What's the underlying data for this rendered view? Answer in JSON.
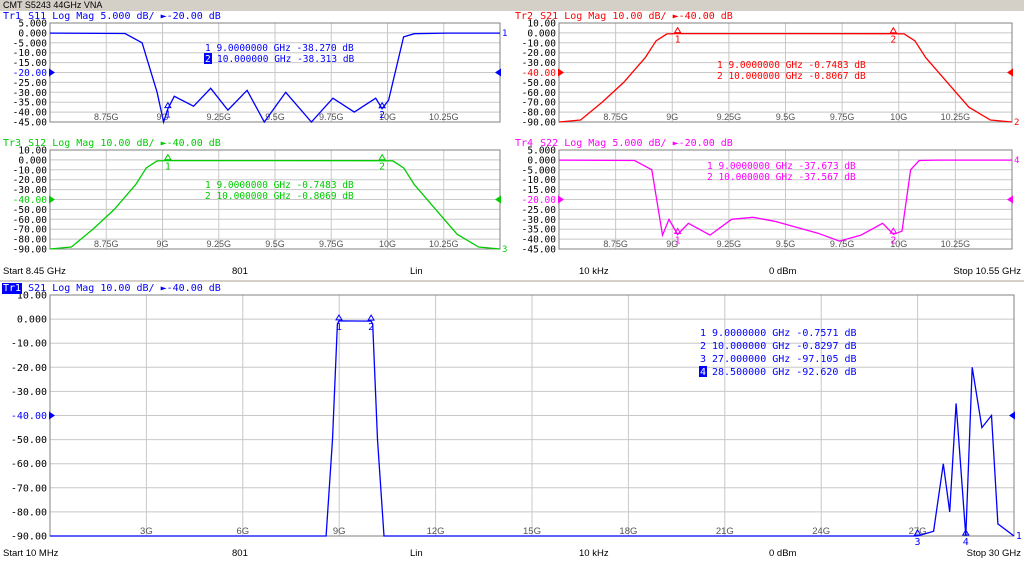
{
  "window_title": "CMT S5243 44GHz VNA",
  "colors": {
    "tr1": "#0000ff",
    "tr2": "#ff0000",
    "tr3": "#00cc00",
    "tr4": "#ff00ff",
    "grid": "#c8c8c8"
  },
  "top_status": {
    "start": "Start 8.45 GHz",
    "points": "801",
    "sweep": "Lin",
    "ifbw": "10 kHz",
    "power": "0 dBm",
    "stop": "Stop 10.55 GHz"
  },
  "bottom_status": {
    "start": "Start 10 MHz",
    "points": "801",
    "sweep": "Lin",
    "ifbw": "10 kHz",
    "power": "0 dBm",
    "stop": "Stop 30 GHz"
  },
  "channels": [
    {
      "id": "tr1-s11",
      "trace": "Tr1",
      "param": "S11",
      "format": "Log Mag",
      "scale": "5.000 dB/",
      "ref_level": "-20.00 dB",
      "color": "#0000ff",
      "ref_marker": "1",
      "ylabels": [
        "5.000",
        "0.000",
        "-5.000",
        "-10.00",
        "-15.00",
        "-20.00",
        "-25.00",
        "-30.00",
        "-35.00",
        "-40.00",
        "-45.00"
      ],
      "xticks": [
        "8.75G",
        "9G",
        "9.25G",
        "9.5G",
        "9.75G",
        "10G",
        "10.25G"
      ],
      "markers": [
        {
          "n": "1",
          "label": "1  9.0000000 GHz -38.270 dB",
          "active": false
        },
        {
          "n": "2",
          "label": "10.000000 GHz -38.313 dB",
          "active": true
        }
      ]
    },
    {
      "id": "tr2-s21",
      "trace": "Tr2",
      "param": "S21",
      "format": "Log Mag",
      "scale": "10.00 dB/",
      "ref_level": "-40.00 dB",
      "color": "#ff0000",
      "ref_marker": "2",
      "ylabels": [
        "10.00",
        "0.000",
        "-10.00",
        "-20.00",
        "-30.00",
        "-40.00",
        "-50.00",
        "-60.00",
        "-70.00",
        "-80.00",
        "-90.00"
      ],
      "xticks": [
        "8.75G",
        "9G",
        "9.25G",
        "9.5G",
        "9.75G",
        "10G",
        "10.25G"
      ],
      "markers": [
        {
          "n": "1",
          "label": "1  9.0000000 GHz -0.7483 dB",
          "active": false
        },
        {
          "n": "2",
          "label": "2  10.000000 GHz -0.8067 dB",
          "active": false
        }
      ]
    },
    {
      "id": "tr3-s12",
      "trace": "Tr3",
      "param": "S12",
      "format": "Log Mag",
      "scale": "10.00 dB/",
      "ref_level": "-40.00 dB",
      "color": "#00cc00",
      "ref_marker": "3",
      "ylabels": [
        "10.00",
        "0.000",
        "-10.00",
        "-20.00",
        "-30.00",
        "-40.00",
        "-50.00",
        "-60.00",
        "-70.00",
        "-80.00",
        "-90.00"
      ],
      "xticks": [
        "8.75G",
        "9G",
        "9.25G",
        "9.5G",
        "9.75G",
        "10G",
        "10.25G"
      ],
      "markers": [
        {
          "n": "1",
          "label": "1  9.0000000 GHz -0.7483 dB",
          "active": false
        },
        {
          "n": "2",
          "label": "2  10.000000 GHz -0.8069 dB",
          "active": false
        }
      ]
    },
    {
      "id": "tr4-s22",
      "trace": "Tr4",
      "param": "S22",
      "format": "Log Mag",
      "scale": "5.000 dB/",
      "ref_level": "-20.00 dB",
      "color": "#ff00ff",
      "ref_marker": "4",
      "ylabels": [
        "5.000",
        "0.000",
        "-5.000",
        "-10.00",
        "-15.00",
        "-20.00",
        "-25.00",
        "-30.00",
        "-35.00",
        "-40.00",
        "-45.00"
      ],
      "xticks": [
        "8.75G",
        "9G",
        "9.25G",
        "9.5G",
        "9.75G",
        "10G",
        "10.25G"
      ],
      "markers": [
        {
          "n": "1",
          "label": "1  9.0000000 GHz -37.673 dB",
          "active": false
        },
        {
          "n": "2",
          "label": "2  10.000000 GHz -37.567 dB",
          "active": false
        }
      ]
    },
    {
      "id": "tr1-s21-wide",
      "trace": "Tr1",
      "param": "S21",
      "format": "Log Mag",
      "scale": "10.00 dB/",
      "ref_level": "-40.00 dB",
      "color": "#0000ff",
      "ref_marker": "1",
      "ylabels": [
        "10.00",
        "0.000",
        "-10.00",
        "-20.00",
        "-30.00",
        "-40.00",
        "-50.00",
        "-60.00",
        "-70.00",
        "-80.00",
        "-90.00"
      ],
      "xticks": [
        "3G",
        "6G",
        "9G",
        "12G",
        "15G",
        "18G",
        "21G",
        "24G",
        "27G"
      ],
      "markers": [
        {
          "n": "1",
          "label": "1  9.0000000 GHz -0.7571 dB",
          "active": false
        },
        {
          "n": "2",
          "label": "2  10.000000 GHz -0.8297 dB",
          "active": false
        },
        {
          "n": "3",
          "label": "3  27.000000 GHz -97.105 dB",
          "active": false
        },
        {
          "n": "4",
          "label": "28.500000 GHz -92.620 dB",
          "active": true
        }
      ]
    }
  ],
  "chart_data": [
    {
      "type": "line",
      "title": "Tr1 S11 Log Mag 5.000 dB/ ►-20.00 dB",
      "xlim": [
        "8.45 GHz",
        "10.55 GHz"
      ],
      "ylim": [
        -45,
        5
      ],
      "series": [
        {
          "name": "S11",
          "x": [
            8.45,
            8.8,
            8.88,
            8.95,
            8.98,
            9.0,
            9.03,
            9.12,
            9.2,
            9.28,
            9.37,
            9.45,
            9.55,
            9.67,
            9.77,
            9.87,
            9.97,
            10.0,
            10.03,
            10.1,
            10.15,
            10.3,
            10.55
          ],
          "y": [
            -0.1,
            -0.3,
            -5,
            -30,
            -45,
            -38.3,
            -32,
            -37,
            -28,
            -39,
            -29,
            -45,
            -30,
            -45,
            -33,
            -40,
            -33,
            -38.3,
            -34,
            -2,
            -0.4,
            -0.1,
            -0.1
          ]
        }
      ],
      "markers": [
        {
          "x": 9.0,
          "y": -38.27
        },
        {
          "x": 10.0,
          "y": -38.313
        }
      ]
    },
    {
      "type": "line",
      "title": "Tr2 S21 Log Mag 10.00 dB/ ►-40.00 dB",
      "xlim": [
        "8.45 GHz",
        "10.55 GHz"
      ],
      "ylim": [
        -90,
        10
      ],
      "series": [
        {
          "name": "S21",
          "x": [
            8.45,
            8.55,
            8.65,
            8.75,
            8.85,
            8.9,
            8.95,
            9.0,
            9.5,
            10.0,
            10.05,
            10.1,
            10.15,
            10.25,
            10.35,
            10.45,
            10.55
          ],
          "y": [
            -90,
            -88,
            -70,
            -50,
            -25,
            -8,
            -1,
            -0.75,
            -0.75,
            -0.81,
            -1,
            -8,
            -25,
            -50,
            -75,
            -88,
            -90
          ]
        }
      ],
      "markers": [
        {
          "x": 9.0,
          "y": -0.7483
        },
        {
          "x": 10.0,
          "y": -0.8067
        }
      ]
    },
    {
      "type": "line",
      "title": "Tr3 S12 Log Mag 10.00 dB/ ►-40.00 dB",
      "xlim": [
        "8.45 GHz",
        "10.55 GHz"
      ],
      "ylim": [
        -90,
        10
      ],
      "series": [
        {
          "name": "S12",
          "x": [
            8.45,
            8.55,
            8.65,
            8.75,
            8.85,
            8.9,
            8.95,
            9.0,
            9.5,
            10.0,
            10.05,
            10.1,
            10.15,
            10.25,
            10.35,
            10.45,
            10.55
          ],
          "y": [
            -90,
            -88,
            -70,
            -50,
            -25,
            -8,
            -1,
            -0.75,
            -0.75,
            -0.81,
            -1,
            -8,
            -25,
            -50,
            -75,
            -88,
            -90
          ]
        }
      ],
      "markers": [
        {
          "x": 9.0,
          "y": -0.7483
        },
        {
          "x": 10.0,
          "y": -0.8069
        }
      ]
    },
    {
      "type": "line",
      "title": "Tr4 S22 Log Mag 5.000 dB/ ►-20.00 dB",
      "xlim": [
        "8.45 GHz",
        "10.55 GHz"
      ],
      "ylim": [
        -45,
        5
      ],
      "series": [
        {
          "name": "S22",
          "x": [
            8.45,
            8.8,
            8.88,
            8.93,
            8.96,
            9.0,
            9.05,
            9.15,
            9.25,
            9.35,
            9.45,
            9.55,
            9.65,
            9.75,
            9.85,
            9.95,
            10.0,
            10.04,
            10.08,
            10.12,
            10.2,
            10.55
          ],
          "y": [
            -0.1,
            -0.3,
            -5,
            -38,
            -30,
            -37.7,
            -32,
            -38,
            -30,
            -29,
            -31,
            -34,
            -37,
            -41,
            -38,
            -32,
            -37.6,
            -36,
            -5,
            -0.3,
            -0.1,
            -0.1
          ]
        }
      ],
      "markers": [
        {
          "x": 9.0,
          "y": -37.673
        },
        {
          "x": 10.0,
          "y": -37.567
        }
      ]
    },
    {
      "type": "line",
      "title": "Tr1 S21 Log Mag 10.00 dB/ ►-40.00 dB",
      "xlim": [
        "10 MHz",
        "30 GHz"
      ],
      "ylim": [
        -90,
        10
      ],
      "series": [
        {
          "name": "S21",
          "x": [
            0.01,
            8.6,
            8.8,
            8.95,
            9.0,
            10.0,
            10.05,
            10.2,
            10.4,
            26.8,
            27.0,
            27.5,
            27.8,
            28.0,
            28.2,
            28.5,
            28.7,
            29.0,
            29.3,
            29.5,
            30.0
          ],
          "y": [
            -90,
            -90,
            -50,
            -2,
            -0.76,
            -0.83,
            -2,
            -50,
            -90,
            -90,
            -97.1,
            -88,
            -60,
            -80,
            -35,
            -92.6,
            -20,
            -45,
            -40,
            -85,
            -90
          ]
        }
      ],
      "markers": [
        {
          "x": 9.0,
          "y": -0.7571
        },
        {
          "x": 10.0,
          "y": -0.8297
        },
        {
          "x": 27.0,
          "y": -97.105
        },
        {
          "x": 28.5,
          "y": -92.62
        }
      ]
    }
  ]
}
